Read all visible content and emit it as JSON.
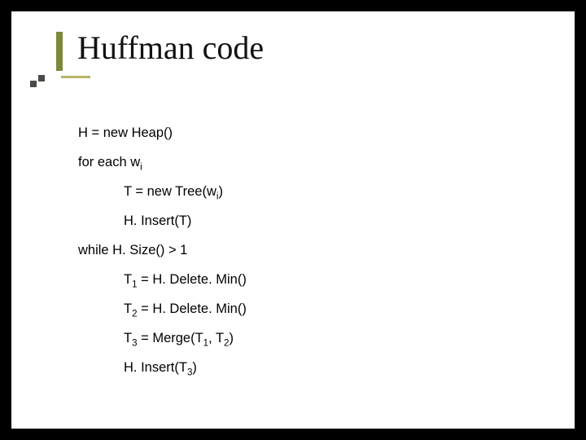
{
  "title": "Huffman code",
  "lines": {
    "l0": "H = new Heap()",
    "l1_pre": "for each w",
    "l1_sub": "i",
    "l2_pre": "T = new Tree(w",
    "l2_sub": "i",
    "l2_post": ")",
    "l3": "H. Insert(T)",
    "l4": "while H. Size() > 1",
    "l5_pre": "T",
    "l5_sub": "1",
    "l5_post": " = H. Delete. Min()",
    "l6_pre": "T",
    "l6_sub": "2",
    "l6_post": " = H. Delete. Min()",
    "l7_pre": "T",
    "l7_sub": "3",
    "l7_mid": " = Merge(T",
    "l7_sub2": "1",
    "l7_mid2": ", T",
    "l7_sub3": "2",
    "l7_post": ")",
    "l8_pre": "H. Insert(T",
    "l8_sub": "3",
    "l8_post": ")"
  }
}
